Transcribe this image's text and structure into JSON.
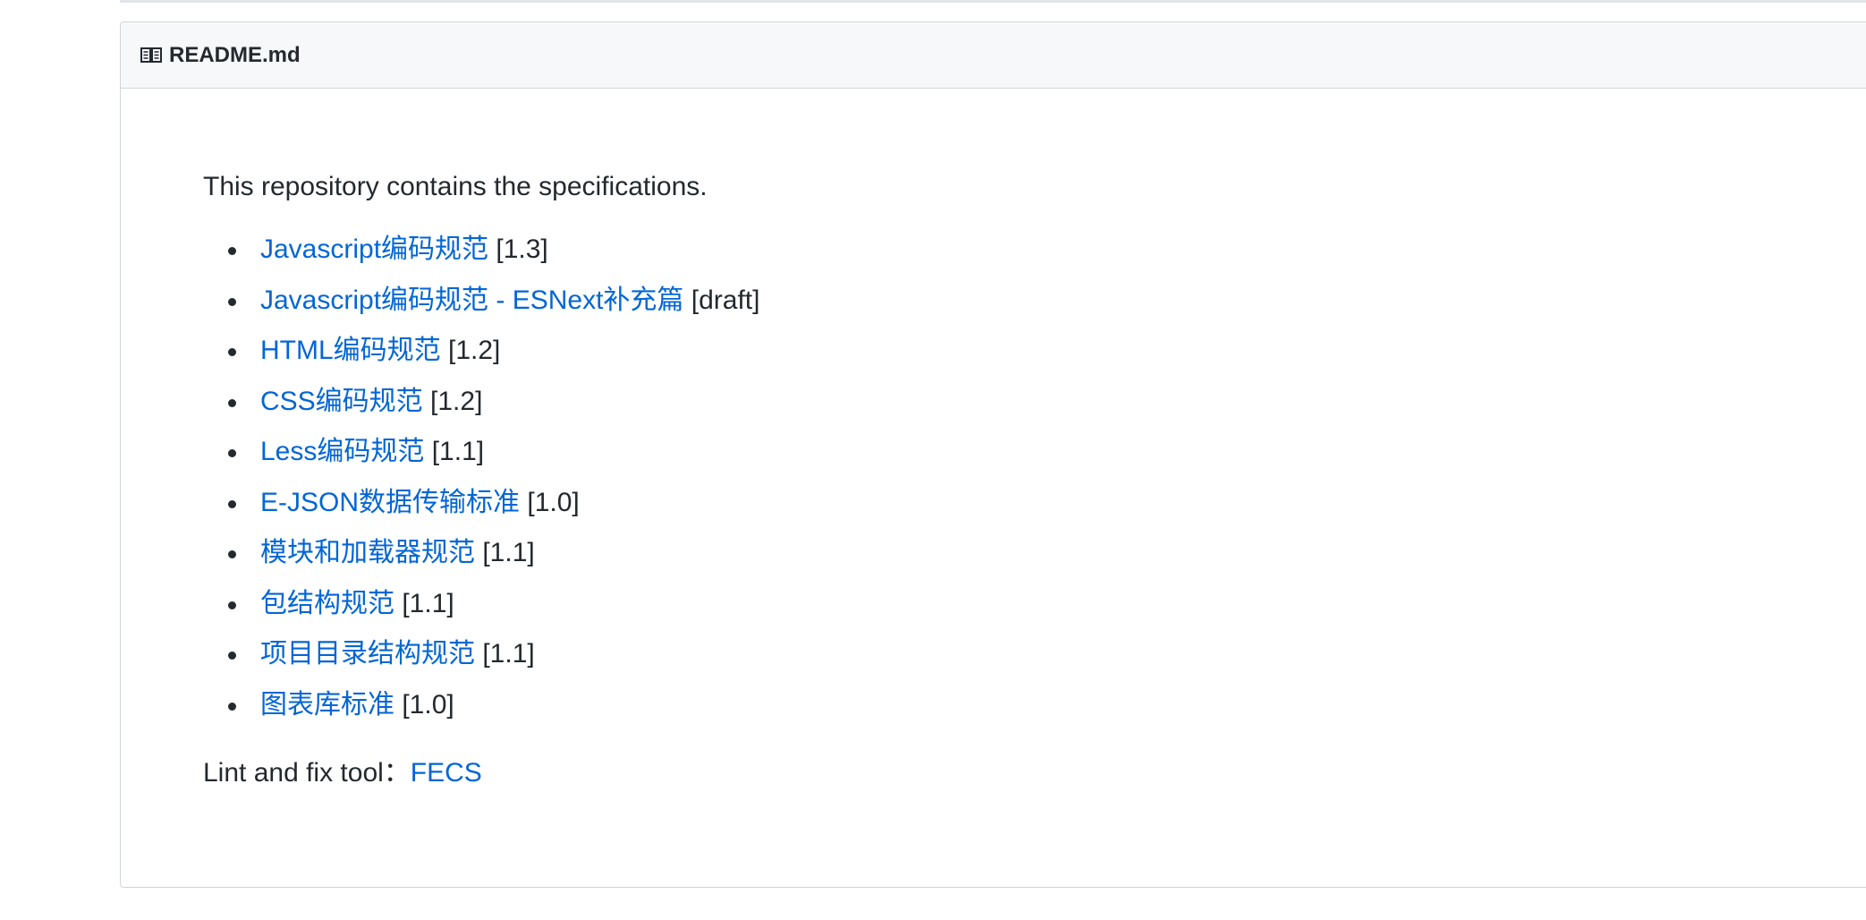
{
  "readme": {
    "title": "README.md",
    "intro": "This repository contains the specifications.",
    "specs": [
      {
        "label": "Javascript编码规范",
        "version": "[1.3]"
      },
      {
        "label": "Javascript编码规范 - ESNext补充篇",
        "version": "[draft]"
      },
      {
        "label": "HTML编码规范",
        "version": "[1.2]"
      },
      {
        "label": "CSS编码规范",
        "version": "[1.2]"
      },
      {
        "label": "Less编码规范",
        "version": "[1.1]"
      },
      {
        "label": "E-JSON数据传输标准",
        "version": "[1.0]"
      },
      {
        "label": "模块和加载器规范",
        "version": "[1.1]"
      },
      {
        "label": "包结构规范",
        "version": "[1.1]"
      },
      {
        "label": "项目目录结构规范",
        "version": "[1.1]"
      },
      {
        "label": "图表库标准",
        "version": "[1.0]"
      }
    ],
    "lint_label": "Lint and fix tool：",
    "lint_link": "FECS"
  },
  "colors": {
    "link": "#0366d6",
    "text": "#24292e",
    "header_bg": "#f6f8fa",
    "border": "#d1d5da"
  }
}
